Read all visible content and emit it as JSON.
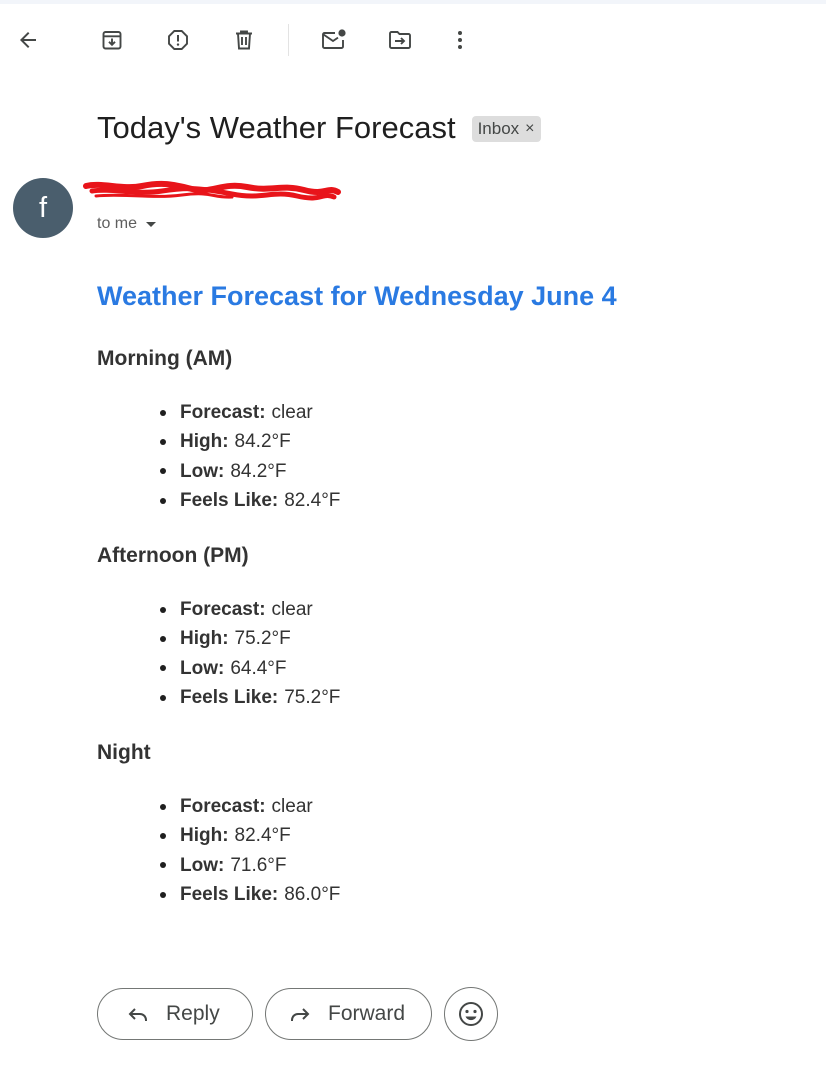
{
  "toolbar": {
    "back": "back-arrow-icon",
    "archive": "archive-icon",
    "report_spam": "report-spam-icon",
    "delete": "trash-icon",
    "mark_unread": "mark-unread-icon",
    "move_to": "move-to-icon",
    "more": "more-vert-icon"
  },
  "email": {
    "subject": "Today's Weather Forecast",
    "label": "Inbox",
    "label_close": "×",
    "sender_initial": "f",
    "recipient_text": "to me"
  },
  "content": {
    "headline": "Weather Forecast for Wednesday June 4",
    "headline_color": "#2a7ae2",
    "sections": [
      {
        "title": "Morning (AM)",
        "items": [
          {
            "key": "Forecast:",
            "value": "clear"
          },
          {
            "key": "High:",
            "value": "84.2°F"
          },
          {
            "key": "Low:",
            "value": "84.2°F"
          },
          {
            "key": "Feels Like:",
            "value": "82.4°F"
          }
        ]
      },
      {
        "title": "Afternoon (PM)",
        "items": [
          {
            "key": "Forecast:",
            "value": "clear"
          },
          {
            "key": "High:",
            "value": "75.2°F"
          },
          {
            "key": "Low:",
            "value": "64.4°F"
          },
          {
            "key": "Feels Like:",
            "value": "75.2°F"
          }
        ]
      },
      {
        "title": "Night",
        "items": [
          {
            "key": "Forecast:",
            "value": "clear"
          },
          {
            "key": "High:",
            "value": "82.4°F"
          },
          {
            "key": "Low:",
            "value": "71.6°F"
          },
          {
            "key": "Feels Like:",
            "value": "86.0°F"
          }
        ]
      }
    ]
  },
  "actions": {
    "reply_label": "Reply",
    "forward_label": "Forward",
    "emoji": "emoji-reaction-icon"
  },
  "colors": {
    "avatar_bg": "#4a5e6d",
    "redaction": "#e8141a"
  }
}
